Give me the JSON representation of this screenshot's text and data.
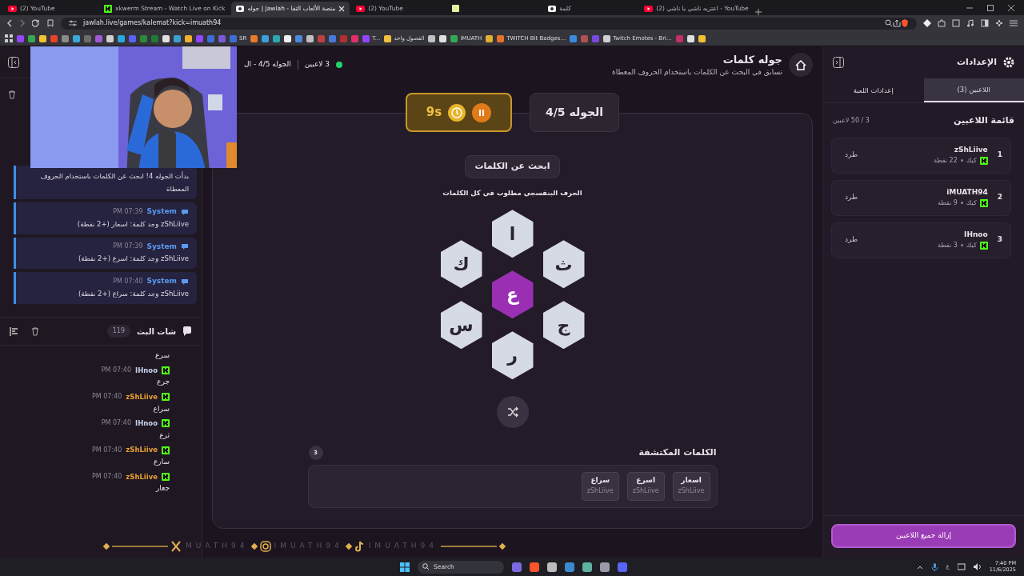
{
  "browser": {
    "tabs": [
      {
        "title": "(2) اعتزيه ناشي يا ناشي - YouTube",
        "kind": "youtube",
        "selected": false
      },
      {
        "title": "كلمة",
        "kind": "site",
        "selected": false
      },
      {
        "kind": "note",
        "selected": false
      },
      {
        "title": "(2) YouTube",
        "kind": "youtube",
        "selected": false
      },
      {
        "title": "جوله | Jawlah - منصة الألعاب التفا",
        "kind": "site",
        "selected": true
      },
      {
        "title": "xkwerm Stream - Watch Live on Kick",
        "kind": "kick",
        "selected": false
      },
      {
        "title": "(2) YouTube",
        "kind": "youtube",
        "selected": false
      }
    ],
    "address": "jawlah.live/games/kalemat?kick=imuath94",
    "bookmarks": [
      {
        "color": "#f0c030"
      },
      {
        "color": "#e0e0e0"
      },
      {
        "color": "#c03060"
      },
      {
        "label": "Twitch Emotes - Bri...",
        "color": "#d0d0d0"
      },
      {
        "color": "#7a4ae0"
      },
      {
        "color": "#b05050"
      },
      {
        "color": "#3a8ae0"
      },
      {
        "label": "TWITCH Bit Badges...",
        "color": "#e8702a"
      },
      {
        "color": "#e0b030"
      },
      {
        "label": "iMUATH",
        "color": "#34a853"
      },
      {
        "color": "#e0e0e0"
      },
      {
        "color": "#c0c0c0"
      },
      {
        "label": "الفصول واحد",
        "color": "#f0c040"
      },
      {
        "label": "T...",
        "color": "#9146ff"
      },
      {
        "color": "#e0306a"
      },
      {
        "color": "#b03030"
      },
      {
        "color": "#4a7ad8"
      },
      {
        "color": "#c04040"
      },
      {
        "color": "#c0c0c0"
      },
      {
        "color": "#4a8ad8"
      },
      {
        "color": "#f0f0f0"
      },
      {
        "color": "#2aa8b0"
      },
      {
        "color": "#3aa0d8"
      },
      {
        "color": "#e87a2a"
      },
      {
        "label": "SR",
        "color": "#3b6fd8"
      },
      {
        "color": "#7a5ad8"
      },
      {
        "color": "#3b6fd8"
      },
      {
        "color": "#9146ff"
      },
      {
        "color": "#f0b030"
      },
      {
        "color": "#3aa0d0"
      },
      {
        "color": "#e0e0e0"
      },
      {
        "color": "#1f7a3a"
      },
      {
        "color": "#2a8a3a"
      },
      {
        "color": "#5865f2"
      },
      {
        "color": "#2aa8e0"
      },
      {
        "color": "#d0d0d0"
      },
      {
        "color": "#a05ad8"
      },
      {
        "color": "#6c6c6c"
      },
      {
        "color": "#3aa7d8"
      },
      {
        "color": "#8a8a8a"
      },
      {
        "color": "#e8412c"
      },
      {
        "color": "#f2c230"
      },
      {
        "color": "#34a853"
      },
      {
        "color": "#9146ff"
      }
    ]
  },
  "header": {
    "title": "جوله كلمات",
    "subtitle": "تسابق في البحث عن الكلمات باستخدام الحروف المعطاة",
    "players_online": "3 لاعبين",
    "round_info": "الجوله 4/5 - ال"
  },
  "system_messages": [
    {
      "text": "بدأت الجوله 4! ابحث عن الكلمات باستخدام الحروف المعطاة"
    },
    {
      "sender": "System",
      "time": "07:39 PM",
      "text": "zShLiive وجد كلمة: اسعار (+2 نقطة)"
    },
    {
      "sender": "System",
      "time": "07:39 PM",
      "text": "zShLiive وجد كلمة: اسرع (+2 نقطة)"
    },
    {
      "sender": "System",
      "time": "07:40 PM",
      "text": "zShLiive وجد كلمة: سراع (+2 نقطة)"
    }
  ],
  "chat": {
    "title": "شات البث",
    "count": "119",
    "messages": [
      {
        "text": "سرع"
      },
      {
        "user": "IHnoo",
        "time": "07:40 PM",
        "color": "#c8d2ee",
        "text": "جرع"
      },
      {
        "user": "zShLiive",
        "time": "07:40 PM",
        "color": "#e8a030",
        "text": "سراع"
      },
      {
        "user": "IHnoo",
        "time": "07:40 PM",
        "color": "#c8d2ee",
        "text": "ثرع"
      },
      {
        "user": "zShLiive",
        "time": "07:40 PM",
        "color": "#e8a030",
        "text": "سارع"
      },
      {
        "user": "zShLiive",
        "time": "07:40 PM",
        "color": "#e8a030",
        "text": "جعار"
      }
    ]
  },
  "game": {
    "round": "الجوله 4/5",
    "timer": "9s",
    "prompt": "ابحث عن الكلمات",
    "hint": "الحرف البنفسجي مطلوب في كل الكلمات",
    "center_letter": "ع",
    "outer_letters": [
      "ا",
      "ث",
      "ج",
      "ر",
      "س",
      "ك"
    ],
    "found_title": "الكلمات المكتشفة",
    "found_count": "3",
    "found_words": [
      {
        "word": "اسعار",
        "player": "zShLiive"
      },
      {
        "word": "اسرع",
        "player": "zShLiive"
      },
      {
        "word": "سراع",
        "player": "zShLiive"
      }
    ]
  },
  "settings": {
    "title": "الإعدادات",
    "tabs": [
      {
        "label": "اللاعبين (3)",
        "selected": true
      },
      {
        "label": "إعدادات اللعبة",
        "selected": false
      }
    ],
    "list_title": "قائمة اللاعبين",
    "capacity": "3 / 50 لاعبين",
    "players": [
      {
        "rank": "1",
        "name": "zShLiive",
        "platform": "كيك",
        "points": "22 نقطة",
        "action": "طرد"
      },
      {
        "rank": "2",
        "name": "iMUATH94",
        "platform": "كيك",
        "points": "9 نقطة",
        "action": "طرد"
      },
      {
        "rank": "3",
        "name": "IHnoo",
        "platform": "كيك",
        "points": "3 نقطة",
        "action": "طرد"
      }
    ],
    "remove_all": "إزالة جميع اللاعبين"
  },
  "overlay": {
    "handles": [
      {
        "kind": "music",
        "text": "IMUATH94"
      },
      {
        "kind": "camera",
        "text": "IMUATH94"
      },
      {
        "kind": "x",
        "text": "MUATH94"
      }
    ]
  },
  "taskbar": {
    "search": "Search",
    "ime": "ع",
    "time": "7:40 PM",
    "date": "11/6/2025"
  }
}
